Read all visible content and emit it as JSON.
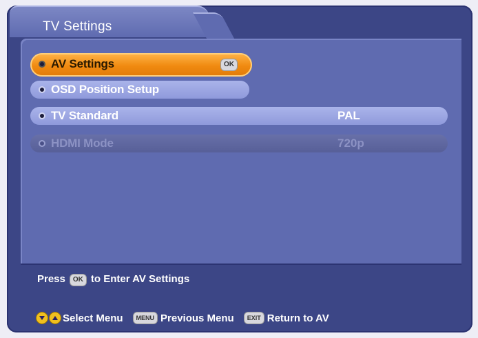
{
  "header": {
    "title": "TV Settings"
  },
  "menu": {
    "items": [
      {
        "label": "AV Settings",
        "value": "",
        "state": "selected",
        "badge": "OK"
      },
      {
        "label": "OSD Position Setup",
        "value": "",
        "state": "normal"
      },
      {
        "label": "TV Standard",
        "value": "PAL",
        "state": "normal"
      },
      {
        "label": "HDMI Mode",
        "value": "720p",
        "state": "disabled"
      }
    ]
  },
  "help": {
    "prefix": "Press",
    "key": "OK",
    "suffix": "to Enter AV Settings"
  },
  "footer": {
    "select_label": "Select Menu",
    "menu_key": "MENU",
    "previous_label": "Previous Menu",
    "exit_key": "EXIT",
    "return_label": "Return to AV"
  },
  "colors": {
    "frame": "#3c4686",
    "panel": "#5f6bb0",
    "selected": "#f08a10",
    "row": "#9ea8e4",
    "disabled_row": "#5f6798"
  }
}
